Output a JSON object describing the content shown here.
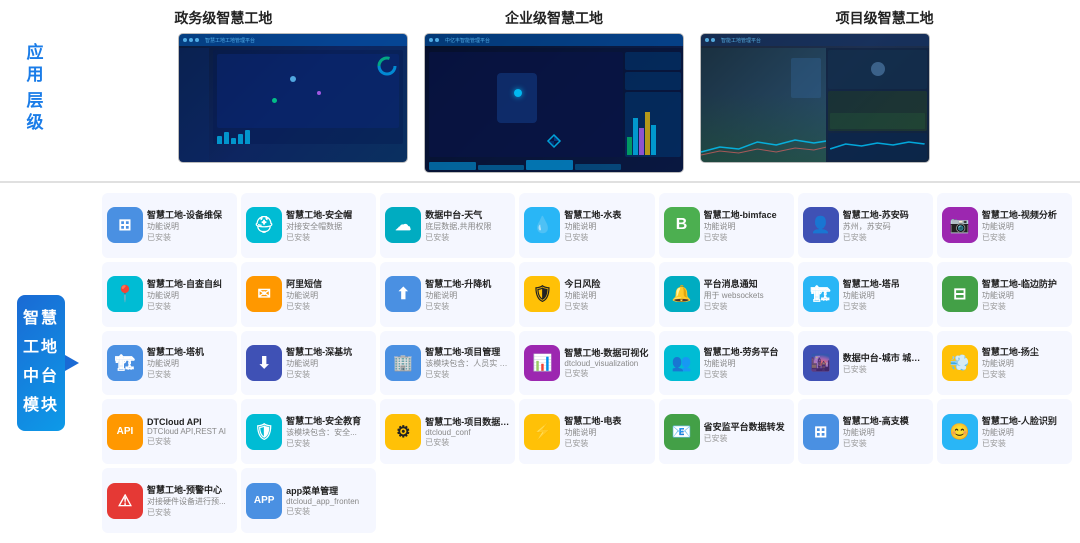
{
  "top": {
    "left_label_line1": "应用",
    "left_label_line2": "层级",
    "screen_titles": [
      "政务级智慧工地",
      "企业级智慧工地",
      "项目级智慧工地"
    ]
  },
  "left_block": {
    "line1": "智慧",
    "line2": "工地",
    "line3": "中台",
    "line4": "模块"
  },
  "modules": [
    {
      "title": "智慧工地-设备维保",
      "desc": "功能说明",
      "status": "已安装",
      "icon": "grid",
      "color": "icon-blue"
    },
    {
      "title": "智慧工地-安全帽",
      "desc": "对接安全帽数据",
      "status": "已安装",
      "icon": "hardhat",
      "color": "icon-teal"
    },
    {
      "title": "数据中台-天气",
      "desc": "底层数据,共用权限",
      "status": "已安装",
      "icon": "cloud",
      "color": "icon-cyan"
    },
    {
      "title": "智慧工地-水表",
      "desc": "功能说明",
      "status": "已安装",
      "icon": "drop",
      "color": "icon-bluelight"
    },
    {
      "title": "智慧工地-bimface",
      "desc": "功能说明",
      "status": "已安装",
      "icon": "bim",
      "color": "icon-bimgreen"
    },
    {
      "title": "智慧工地-苏安码",
      "desc": "苏州，苏安码",
      "status": "已安装",
      "icon": "person",
      "color": "icon-indigo"
    },
    {
      "title": "智慧工地-视频分析",
      "desc": "功能说明",
      "status": "已安装",
      "icon": "monitor",
      "color": "icon-purple"
    },
    {
      "title": "智慧工地-自查自纠",
      "desc": "功能说明",
      "status": "已安装",
      "icon": "location",
      "color": "icon-teal"
    },
    {
      "title": "阿里短信",
      "desc": "功能说明",
      "status": "已安装",
      "icon": "mail",
      "color": "icon-orange"
    },
    {
      "title": "智慧工地-升降机",
      "desc": "功能说明",
      "status": "已安装",
      "icon": "elevator",
      "color": "icon-blue"
    },
    {
      "title": "今日风险",
      "desc": "功能说明",
      "status": "已安装",
      "icon": "shield",
      "color": "icon-amber"
    },
    {
      "title": "平台消息通知",
      "desc": "用于 websockets",
      "status": "已安装",
      "icon": "bell",
      "color": "icon-cyan"
    },
    {
      "title": "智慧工地-塔吊",
      "desc": "功能说明",
      "status": "已安装",
      "icon": "crane",
      "color": "icon-bluelight"
    },
    {
      "title": "智慧工地-临边防护",
      "desc": "功能说明",
      "status": "已安装",
      "icon": "fence",
      "color": "icon-green"
    },
    {
      "title": "智慧工地-塔机",
      "desc": "功能说明",
      "status": "已安装",
      "icon": "crane2",
      "color": "icon-blue"
    },
    {
      "title": "智慧工地-深基坑",
      "desc": "功能说明",
      "status": "已安装",
      "icon": "pit",
      "color": "icon-indigo"
    },
    {
      "title": "智慧工地-项目管理",
      "desc": "该模块包含：人员实\n管理、预警等",
      "status": "已安装",
      "icon": "building",
      "color": "icon-blue"
    },
    {
      "title": "智慧工地-数据可视化",
      "desc": "dtcloud_visualization",
      "status": "已安装",
      "icon": "chart",
      "color": "icon-purple"
    },
    {
      "title": "智慧工地-劳务平台",
      "desc": "功能说明",
      "status": "已安装",
      "icon": "people",
      "color": "icon-teal"
    },
    {
      "title": "数据中台-城市\n城际信息",
      "desc": "",
      "status": "已安装",
      "icon": "city",
      "color": "icon-indigo"
    },
    {
      "title": "智慧工地-扬尘",
      "desc": "功能说明",
      "status": "已安装",
      "icon": "dust",
      "color": "icon-amber"
    },
    {
      "title": "DTCloud API",
      "desc": "DTCloud API,REST AI",
      "status": "已安装",
      "icon": "api",
      "color": "icon-orange"
    },
    {
      "title": "智慧工地-安全教育",
      "desc": "该模块包含：安全...",
      "status": "已安装",
      "icon": "shield2",
      "color": "icon-teal"
    },
    {
      "title": "智慧工地-项目数据初始化",
      "desc": "dtcloud_conf",
      "status": "已安装",
      "icon": "gear",
      "color": "icon-amber"
    },
    {
      "title": "智慧工地-电表",
      "desc": "功能说明",
      "status": "已安装",
      "icon": "bolt",
      "color": "icon-amber"
    },
    {
      "title": "省安监平台数据转发",
      "desc": "",
      "status": "已安装",
      "icon": "mail2",
      "color": "icon-green"
    },
    {
      "title": "智慧工地-高支模",
      "desc": "功能说明",
      "status": "已安装",
      "icon": "scaffold",
      "color": "icon-blue"
    },
    {
      "title": "智慧工地-人脸识别",
      "desc": "功能说明",
      "status": "已安装",
      "icon": "face",
      "color": "icon-bluelight"
    },
    {
      "title": "智慧工地-预警中心",
      "desc": "对接硬件设备进行预...",
      "status": "已安装",
      "icon": "warning",
      "color": "icon-red"
    },
    {
      "title": "app菜单管理",
      "desc": "dtcloud_app_fronten",
      "status": "已安装",
      "icon": "app",
      "color": "icon-blue"
    }
  ],
  "icons": {
    "grid": "⊞",
    "hardhat": "⛑",
    "cloud": "☁",
    "drop": "💧",
    "bim": "B",
    "person": "👤",
    "monitor": "🖥",
    "location": "📍",
    "mail": "✉",
    "elevator": "🔼",
    "shield": "🛡",
    "bell": "🔔",
    "crane": "🏗",
    "fence": "⊞",
    "crane2": "🏗",
    "pit": "⬇",
    "building": "🏢",
    "chart": "📊",
    "people": "👥",
    "city": "🌆",
    "dust": "💨",
    "api": "API",
    "shield2": "🛡",
    "gear": "⚙",
    "bolt": "⚡",
    "mail2": "📧",
    "scaffold": "⊞",
    "face": "😊",
    "warning": "⚠",
    "app": "APP"
  }
}
